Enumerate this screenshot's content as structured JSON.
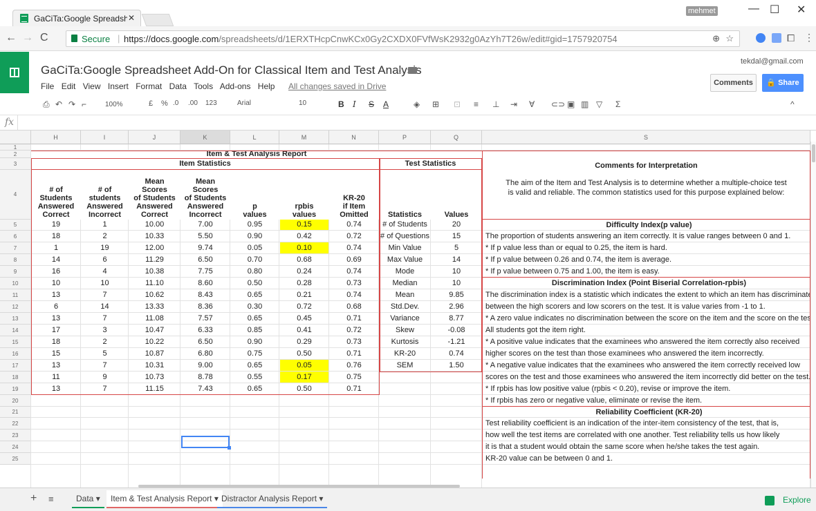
{
  "browser": {
    "tab_title": "GaCiTa:Google Spreadsh",
    "user": "mehmet",
    "secure_label": "Secure",
    "url_host": "https://docs.google.com",
    "url_path": "/spreadsheets/d/1ERXTHcpCnwKCx0Gy2CXDX0FVfWsK2932g0AzYh7T26w/edit#gid=1757920754"
  },
  "doc": {
    "title": "GaCiTa:Google Spreadsheet Add-On for Classical Item and Test Analysis",
    "menus": [
      "File",
      "Edit",
      "View",
      "Insert",
      "Format",
      "Data",
      "Tools",
      "Add-ons",
      "Help"
    ],
    "saved": "All changes saved in Drive",
    "email": "tekdal@gmail.com",
    "comments_btn": "Comments",
    "share_btn": "Share"
  },
  "toolbar": {
    "zoom": "100%",
    "currency": "£",
    "percent": "%",
    "dec_less": ".0",
    "dec_more": ".00",
    "format": "123",
    "font": "Arial",
    "size": "10",
    "bold": "B",
    "italic": "I",
    "strike": "S",
    "textcolor": "A"
  },
  "fx": "fx",
  "columns": [
    "H",
    "I",
    "J",
    "K",
    "L",
    "M",
    "N",
    "P",
    "Q",
    "S"
  ],
  "rows": [
    "1",
    "2",
    "3",
    "4",
    "5",
    "6",
    "7",
    "8",
    "9",
    "10",
    "11",
    "12",
    "13",
    "14",
    "15",
    "16",
    "17",
    "18",
    "19",
    "20",
    "21",
    "22",
    "23",
    "24",
    "25"
  ],
  "report": {
    "title": "Item & Test Analysis Report",
    "item_stats_title": "Item Statistics",
    "headers": [
      [
        "# of",
        "Students",
        "Answered",
        "Correct"
      ],
      [
        "# of",
        "students",
        "Answered",
        "Incorrect"
      ],
      [
        "Mean",
        "Scores",
        "of Students",
        "Answered",
        "Correct"
      ],
      [
        "Mean",
        "Scores",
        "of Students",
        "Answered",
        "Incorrect"
      ],
      [
        "p",
        "values"
      ],
      [
        "rpbis",
        "values"
      ],
      [
        "KR-20",
        "if Item",
        "Omitted"
      ]
    ],
    "item_rows": [
      [
        "19",
        "1",
        "10.00",
        "7.00",
        "0.95",
        "0.15",
        "0.74"
      ],
      [
        "18",
        "2",
        "10.33",
        "5.50",
        "0.90",
        "0.42",
        "0.72"
      ],
      [
        "1",
        "19",
        "12.00",
        "9.74",
        "0.05",
        "0.10",
        "0.74"
      ],
      [
        "14",
        "6",
        "11.29",
        "6.50",
        "0.70",
        "0.68",
        "0.69"
      ],
      [
        "16",
        "4",
        "10.38",
        "7.75",
        "0.80",
        "0.24",
        "0.74"
      ],
      [
        "10",
        "10",
        "11.10",
        "8.60",
        "0.50",
        "0.28",
        "0.73"
      ],
      [
        "13",
        "7",
        "10.62",
        "8.43",
        "0.65",
        "0.21",
        "0.74"
      ],
      [
        "6",
        "14",
        "13.33",
        "8.36",
        "0.30",
        "0.72",
        "0.68"
      ],
      [
        "13",
        "7",
        "11.08",
        "7.57",
        "0.65",
        "0.45",
        "0.71"
      ],
      [
        "17",
        "3",
        "10.47",
        "6.33",
        "0.85",
        "0.41",
        "0.72"
      ],
      [
        "18",
        "2",
        "10.22",
        "6.50",
        "0.90",
        "0.29",
        "0.73"
      ],
      [
        "15",
        "5",
        "10.87",
        "6.80",
        "0.75",
        "0.50",
        "0.71"
      ],
      [
        "13",
        "7",
        "10.31",
        "9.00",
        "0.65",
        "0.05",
        "0.76"
      ],
      [
        "11",
        "9",
        "10.73",
        "8.78",
        "0.55",
        "0.17",
        "0.75"
      ],
      [
        "13",
        "7",
        "11.15",
        "7.43",
        "0.65",
        "0.50",
        "0.71"
      ]
    ],
    "highlighted_rpbis_rows": [
      0,
      2,
      12,
      13
    ],
    "highlight_color": "#ffff00",
    "test_stats_title": "Test Statistics",
    "test_headers": [
      "Statistics",
      "Values"
    ],
    "test_rows": [
      [
        "# of Students",
        "20"
      ],
      [
        "# of Questions",
        "15"
      ],
      [
        "Min Value",
        "5"
      ],
      [
        "Max Value",
        "14"
      ],
      [
        "Mode",
        "10"
      ],
      [
        "Median",
        "10"
      ],
      [
        "Mean",
        "9.85"
      ],
      [
        "Std.Dev.",
        "2.96"
      ],
      [
        "Variance",
        "8.77"
      ],
      [
        "Skew",
        "-0.08"
      ],
      [
        "Kurtosis",
        "-1.21"
      ],
      [
        "KR-20",
        "0.74"
      ],
      [
        "SEM",
        "1.50"
      ]
    ],
    "comments_title": "Comments for Interpretation",
    "intro": [
      "The aim of the Item and Test Analysis is to determine whether a multiple-choice test",
      "is valid and reliable. The common statistics used for this purpose explained below:"
    ],
    "difficulty_title": "Difficulty Index(p value)",
    "difficulty_lines": [
      "The proportion of students answering an item correctly. It is value ranges between 0 and 1.",
      "* If p value less than or equal to 0.25, the item is hard.",
      "* If p value between  0.26 and 0.74, the item is average.",
      "* If p value between  0.75 and 1.00, the item is easy."
    ],
    "discrimination_title": "Discrimination Index (Point Biserial Correlation-rpbis)",
    "discrimination_lines": [
      "The discrimination index is a statistic which indicates the extent to which an item has discriminated",
      "between the high scorers and low scorers on the test. It is value  varies from -1 to 1.",
      "* A zero value indicates no discrimination between the score on the item and the score on the test.",
      "  All students got the item right.",
      "* A positive value  indicates that the examinees who answered the item correctly also received",
      "  higher scores on the test than those examinees who answered the item incorrectly.",
      "* A negative value indicates that the examinees who answered the item correctly received low",
      "  scores on the test and those examinees who answered the item incorrectly did better on the test.",
      "* If rpbis has low positive value (rpbis < 0.20), revise or improve the item.",
      "* If rpbis has  zero or negative value, eliminate or revise the item."
    ],
    "reliability_title": "Reliability Coefficient (KR-20)",
    "reliability_lines": [
      "Test reliability coefficient is an indication of the  inter-item consistency of the test, that is,",
      "how well the test items are correlated with one another. Test reliability tells us how likely",
      "it is that a student would obtain the same score when he/she takes the test again.",
      "KR-20 value can be between 0 and 1."
    ]
  },
  "sheets": {
    "tabs": [
      "Data",
      "Item & Test Analysis Report",
      "Distractor Analysis Report"
    ],
    "active": 1,
    "explore": "Explore"
  }
}
